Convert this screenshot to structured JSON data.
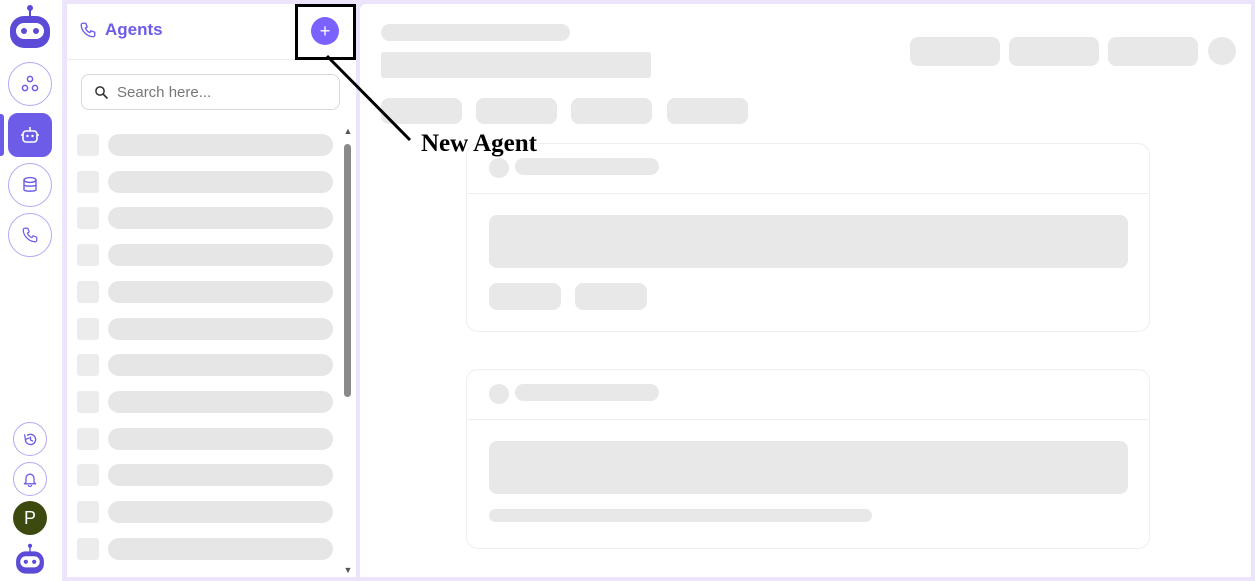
{
  "rail": {
    "logo_icon": "robot-logo-icon",
    "items": [
      {
        "icon": "nodes-icon",
        "active": false
      },
      {
        "icon": "robot-icon",
        "active": true
      },
      {
        "icon": "database-icon",
        "active": false
      },
      {
        "icon": "phone-icon",
        "active": false
      }
    ],
    "bottom": [
      {
        "icon": "history-icon"
      },
      {
        "icon": "bell-icon"
      }
    ],
    "avatar_initial": "P",
    "accent": "#6c5ce7"
  },
  "panel": {
    "title": "Agents",
    "title_icon": "phone-icon",
    "add_button_label": "+",
    "search": {
      "placeholder": "Search here...",
      "value": ""
    },
    "loading_rows": 12
  },
  "annotation": {
    "label": "New Agent"
  },
  "main": {
    "state": "loading-skeleton"
  }
}
